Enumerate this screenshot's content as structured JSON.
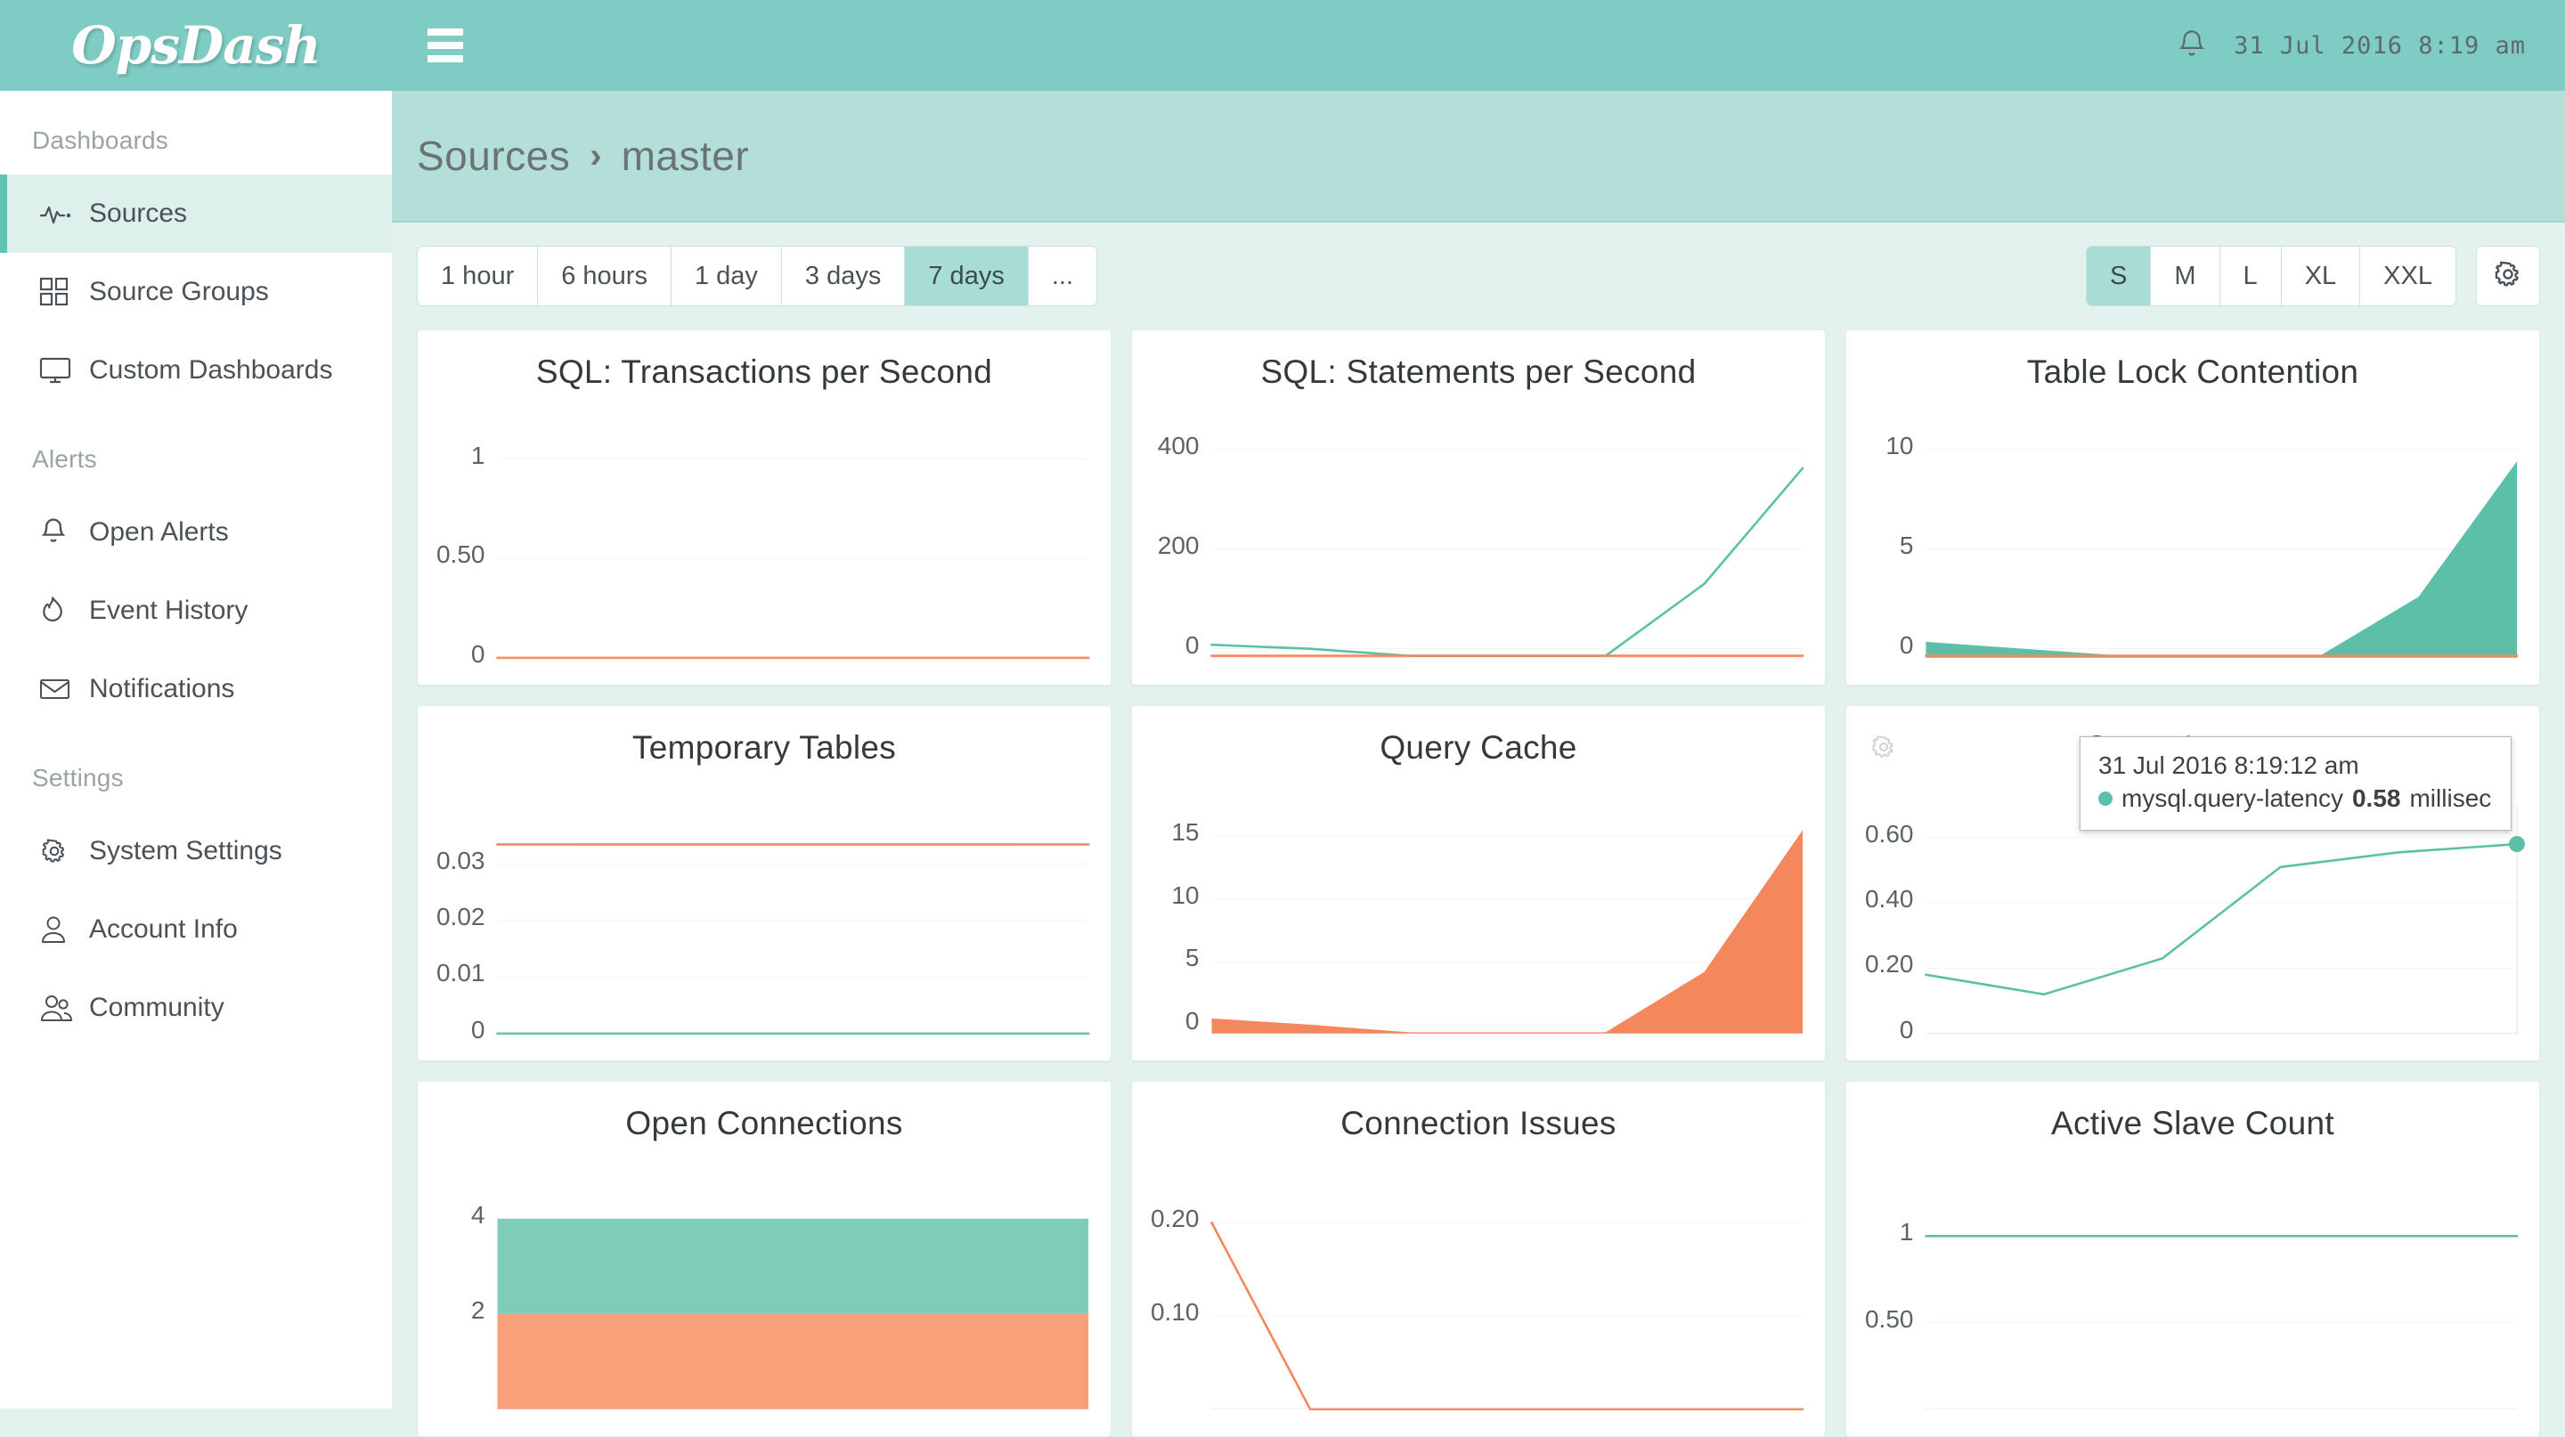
{
  "header": {
    "logo": "OpsDash",
    "menu_icon": "hamburger-icon",
    "bell_icon": "bell-icon",
    "datetime": "31 Jul 2016 8:19 am"
  },
  "sidebar": {
    "sections": [
      {
        "label": "Dashboards",
        "items": [
          {
            "label": "Sources",
            "icon": "pulse-icon",
            "active": true
          },
          {
            "label": "Source Groups",
            "icon": "grid-icon",
            "active": false
          },
          {
            "label": "Custom Dashboards",
            "icon": "monitor-icon",
            "active": false
          }
        ]
      },
      {
        "label": "Alerts",
        "items": [
          {
            "label": "Open Alerts",
            "icon": "bell-icon",
            "active": false
          },
          {
            "label": "Event History",
            "icon": "flame-icon",
            "active": false
          },
          {
            "label": "Notifications",
            "icon": "envelope-icon",
            "active": false
          }
        ]
      },
      {
        "label": "Settings",
        "items": [
          {
            "label": "System Settings",
            "icon": "gear-icon",
            "active": false
          },
          {
            "label": "Account Info",
            "icon": "user-icon",
            "active": false
          },
          {
            "label": "Community",
            "icon": "users-icon",
            "active": false
          }
        ]
      }
    ]
  },
  "breadcrumb": {
    "root": "Sources",
    "separator": "›",
    "current": "master"
  },
  "toolbar": {
    "ranges": [
      {
        "label": "1 hour",
        "active": false
      },
      {
        "label": "6 hours",
        "active": false
      },
      {
        "label": "1 day",
        "active": false
      },
      {
        "label": "3 days",
        "active": false
      },
      {
        "label": "7 days",
        "active": true
      },
      {
        "label": "...",
        "active": false
      }
    ],
    "sizes": [
      {
        "label": "S",
        "active": true
      },
      {
        "label": "M",
        "active": false
      },
      {
        "label": "L",
        "active": false
      },
      {
        "label": "XL",
        "active": false
      },
      {
        "label": "XXL",
        "active": false
      }
    ],
    "settings_icon": "gear-icon"
  },
  "colors": {
    "brand_teal": "#7fccc4",
    "breadcrumb_band": "#b4dfd9",
    "page_bg": "#e3f2ef",
    "series_green": "#5cc0a8",
    "series_orange": "#f4885c",
    "active_nav_bg": "#ddf0ec",
    "active_nav_border": "#62c3b4"
  },
  "tooltip": {
    "time": "31 Jul 2016 8:19:12 am",
    "metric": "mysql.query-latency",
    "value": "0.58",
    "unit": "millisec",
    "dot_color": "#5cc0a8"
  },
  "chart_data": [
    {
      "type": "line",
      "title": "SQL: Transactions per Second",
      "ylim": [
        0,
        1.15
      ],
      "yticks": [
        1,
        0.5,
        0
      ],
      "ytick_labels": [
        "1",
        "0.50",
        "0"
      ],
      "grid": true,
      "series": [
        {
          "name": "orange",
          "color": "#f4885c",
          "fill": false,
          "x": [
            0,
            1,
            2,
            3,
            4,
            5,
            6
          ],
          "values": [
            0,
            0,
            0,
            0,
            0,
            0,
            0
          ]
        }
      ]
    },
    {
      "type": "line",
      "title": "SQL: Statements per Second",
      "ylim": [
        -18,
        440
      ],
      "yticks": [
        400,
        200,
        0
      ],
      "ytick_labels": [
        "400",
        "200",
        "0"
      ],
      "grid": true,
      "series": [
        {
          "name": "green",
          "color": "#5cc0a8",
          "fill": false,
          "x": [
            0,
            1,
            2,
            3,
            4,
            5,
            6
          ],
          "values": [
            8,
            0,
            -14,
            -14,
            -14,
            130,
            362
          ]
        },
        {
          "name": "orange",
          "color": "#f4885c",
          "fill": false,
          "x": [
            0,
            1,
            2,
            3,
            4,
            5,
            6
          ],
          "values": [
            -14,
            -14,
            -14,
            -14,
            -14,
            -14,
            -14
          ]
        }
      ]
    },
    {
      "type": "area",
      "title": "Table Lock Contention",
      "ylim": [
        -0.45,
        11
      ],
      "yticks": [
        10,
        5,
        0
      ],
      "ytick_labels": [
        "10",
        "5",
        "0"
      ],
      "grid": true,
      "series": [
        {
          "name": "green",
          "color": "#5cc0a8",
          "fill": true,
          "x": [
            0,
            1,
            2,
            3,
            4,
            5,
            6
          ],
          "values": [
            0.35,
            0.0,
            -0.35,
            -0.35,
            -0.35,
            2.6,
            9.4
          ]
        },
        {
          "name": "orange",
          "color": "#f4885c",
          "fill": false,
          "x": [
            0,
            1,
            2,
            3,
            4,
            5,
            6
          ],
          "values": [
            -0.35,
            -0.35,
            -0.35,
            -0.35,
            -0.35,
            -0.35,
            -0.35
          ]
        }
      ]
    },
    {
      "type": "line",
      "title": "Temporary Tables",
      "ylim": [
        0,
        0.0405
      ],
      "yticks": [
        0.03,
        0.02,
        0.01,
        0
      ],
      "ytick_labels": [
        "0.03",
        "0.02",
        "0.01",
        "0"
      ],
      "grid": true,
      "series": [
        {
          "name": "orange",
          "color": "#f4885c",
          "fill": false,
          "x": [
            0,
            1,
            2,
            3,
            4,
            5,
            6
          ],
          "values": [
            0.0335,
            0.0335,
            0.0335,
            0.0335,
            0.0335,
            0.0335,
            0.0335
          ]
        },
        {
          "name": "green",
          "color": "#5cc0a8",
          "fill": false,
          "x": [
            0,
            1,
            2,
            3,
            4,
            5,
            6
          ],
          "values": [
            0,
            0,
            0,
            0,
            0,
            0,
            0
          ]
        }
      ]
    },
    {
      "type": "area",
      "title": "Query Cache",
      "ylim": [
        -0.7,
        17.5
      ],
      "yticks": [
        15,
        10,
        5,
        0
      ],
      "ytick_labels": [
        "15",
        "10",
        "5",
        "0"
      ],
      "grid": true,
      "series": [
        {
          "name": "orange",
          "color": "#f4885c",
          "fill": true,
          "x": [
            0,
            1,
            2,
            3,
            4,
            5,
            6
          ],
          "values": [
            0.5,
            0.0,
            -0.6,
            -0.6,
            -0.6,
            4.2,
            15.5
          ]
        }
      ]
    },
    {
      "type": "line",
      "title": "Query Latency",
      "ylim": [
        0,
        0.7
      ],
      "yticks": [
        0.6,
        0.4,
        0.2,
        0
      ],
      "ytick_labels": [
        "0.60",
        "0.40",
        "0.20",
        "0"
      ],
      "grid": true,
      "has_gear": true,
      "cursor_line": true,
      "series": [
        {
          "name": "mysql.query-latency",
          "color": "#5cc0a8",
          "fill": false,
          "marker_last": true,
          "x": [
            0,
            1,
            2,
            3,
            4,
            5
          ],
          "values": [
            0.18,
            0.12,
            0.23,
            0.51,
            0.555,
            0.58
          ]
        }
      ]
    },
    {
      "type": "area",
      "title": "Open Connections",
      "ylim": [
        0,
        4.8
      ],
      "yticks": [
        4,
        2
      ],
      "ytick_labels": [
        "4",
        "2"
      ],
      "grid": true,
      "stacked": true,
      "series": [
        {
          "name": "orange",
          "color": "#f9a07b",
          "fill": true,
          "x": [
            0,
            1,
            2,
            3,
            4,
            5,
            6
          ],
          "values": [
            2,
            2,
            2,
            2,
            2,
            2,
            2
          ]
        },
        {
          "name": "green",
          "color": "#7fccb8",
          "fill": true,
          "x": [
            0,
            1,
            2,
            3,
            4,
            5,
            6
          ],
          "values": [
            2,
            2,
            2,
            2,
            2,
            2,
            2
          ]
        }
      ]
    },
    {
      "type": "line",
      "title": "Connection Issues",
      "ylim": [
        0,
        0.245
      ],
      "yticks": [
        0.2,
        0.1
      ],
      "ytick_labels": [
        "0.20",
        "0.10"
      ],
      "grid": true,
      "series": [
        {
          "name": "orange",
          "color": "#f4885c",
          "fill": false,
          "x": [
            0,
            1,
            2,
            3,
            4,
            5,
            6
          ],
          "values": [
            0.2,
            0.0,
            0.0,
            0.0,
            0.0,
            0.0,
            0.0
          ]
        }
      ]
    },
    {
      "type": "line",
      "title": "Active Slave Count",
      "ylim": [
        0,
        1.32
      ],
      "yticks": [
        1,
        0.5
      ],
      "ytick_labels": [
        "1",
        "0.50"
      ],
      "grid": true,
      "series": [
        {
          "name": "green",
          "color": "#5cc0a8",
          "fill": false,
          "x": [
            0,
            1,
            2,
            3,
            4,
            5,
            6
          ],
          "values": [
            1,
            1,
            1,
            1,
            1,
            1,
            1
          ]
        }
      ]
    }
  ]
}
